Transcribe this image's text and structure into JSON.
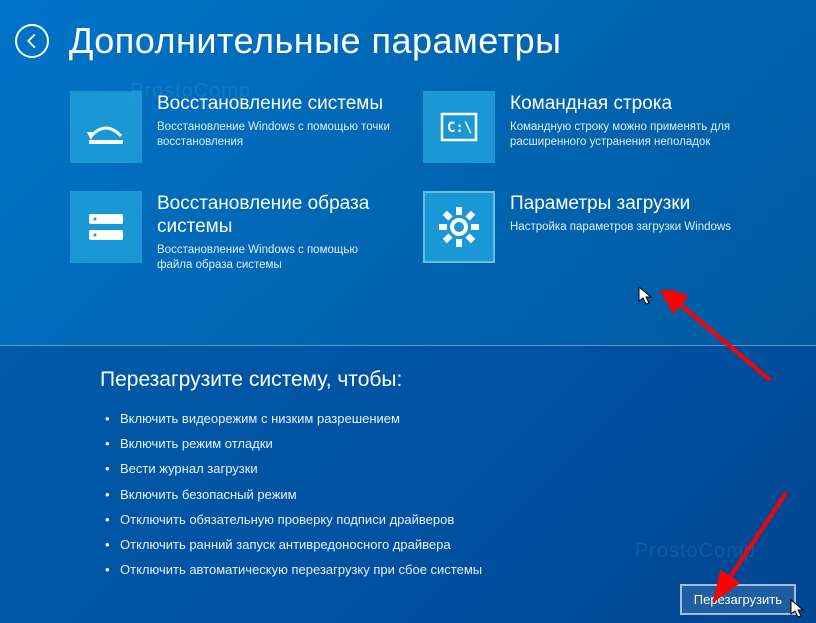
{
  "header": {
    "title": "Дополнительные параметры"
  },
  "tiles": [
    {
      "id": "system-restore",
      "title": "Восстановление системы",
      "desc": "Восстановление Windows с помощью точки восстановления"
    },
    {
      "id": "command-prompt",
      "title": "Командная строка",
      "desc": "Командную строку можно применять для расширенного устранения неполадок"
    },
    {
      "id": "system-image",
      "title": "Восстановление образа системы",
      "desc": "Восстановление Windows с помощью файла образа системы"
    },
    {
      "id": "startup-settings",
      "title": "Параметры загрузки",
      "desc": "Настройка параметров загрузки Windows"
    }
  ],
  "startup": {
    "heading": "Перезагрузите систему, чтобы:",
    "items": [
      "Включить видеорежим с низким разрешением",
      "Включить режим отладки",
      "Вести журнал загрузки",
      "Включить безопасный режим",
      "Отключить обязательную проверку подписи драйверов",
      "Отключить ранний запуск антивредоносного драйвера",
      "Отключить автоматическую перезагрузку при сбое системы"
    ],
    "button_label": "Перезагрузить"
  },
  "accent_tile_bg": "#1998d5"
}
